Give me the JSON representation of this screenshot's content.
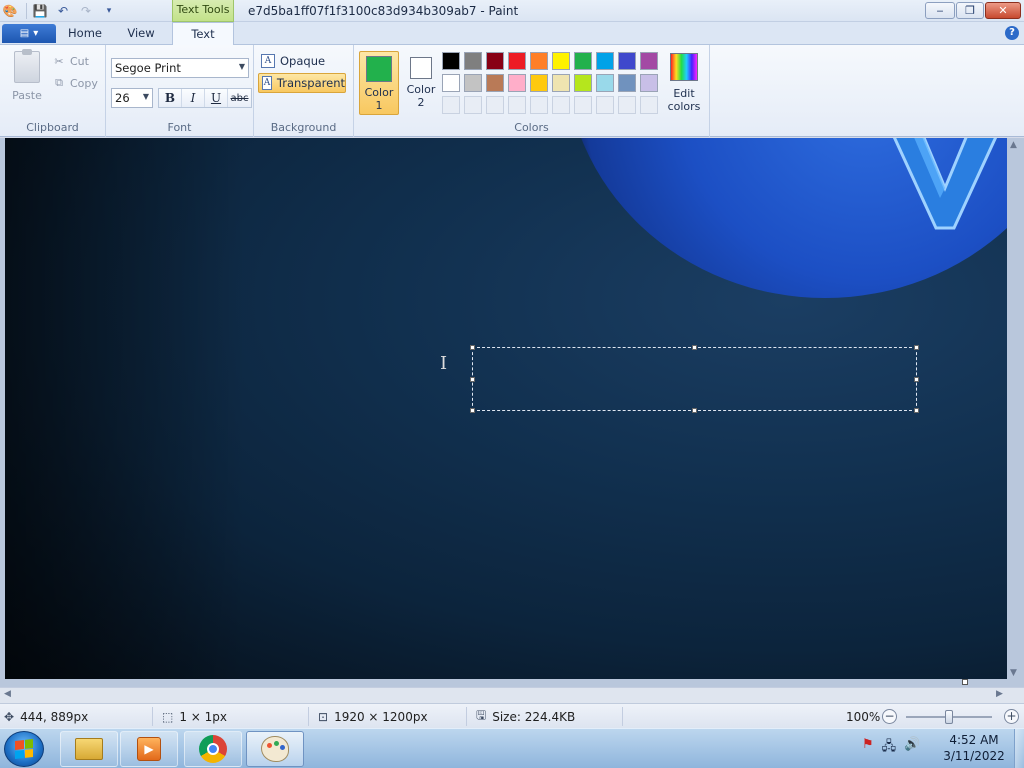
{
  "window": {
    "title": "e7d5ba1ff07f1f3100c83d934b309ab7 - Paint",
    "contextual_tab": "Text Tools",
    "controls": {
      "minimize": "‒",
      "maximize": "❐",
      "close": "✕"
    }
  },
  "ribbon": {
    "tabs": [
      {
        "label": "Home"
      },
      {
        "label": "View"
      },
      {
        "label": "Text",
        "active": true
      }
    ],
    "clipboard": {
      "label": "Clipboard",
      "paste": "Paste",
      "cut": "Cut",
      "copy": "Copy"
    },
    "font": {
      "label": "Font",
      "family": "Segoe Print",
      "size": "26",
      "bold": "B",
      "italic": "I",
      "underline": "U",
      "strikethrough": "abc"
    },
    "background": {
      "label": "Background",
      "opaque": "Opaque",
      "transparent": "Transparent",
      "selected": "Transparent"
    },
    "colors": {
      "label": "Colors",
      "color1_label_line1": "Color",
      "color1_label_line2": "1",
      "color2_label_line1": "Color",
      "color2_label_line2": "2",
      "color1": "#22b14c",
      "color2": "#ffffff",
      "edit_line1": "Edit",
      "edit_line2": "colors",
      "palette": [
        "#000000",
        "#7f7f7f",
        "#880015",
        "#ed1c24",
        "#ff7f27",
        "#fff200",
        "#22b14c",
        "#00a2e8",
        "#3f48cc",
        "#a349a4",
        "#ffffff",
        "#c3c3c3",
        "#b97a57",
        "#ffaec9",
        "#ffc90e",
        "#efe4b0",
        "#b5e61d",
        "#99d9ea",
        "#7092be",
        "#c8bfe7",
        "",
        "",
        "",
        "",
        "",
        "",
        "",
        "",
        "",
        ""
      ]
    }
  },
  "statusbar": {
    "cursor_pos": "444, 889px",
    "selection_size": "1 × 1px",
    "image_size": "1920 × 1200px",
    "file_size": "Size: 224.4KB",
    "zoom": "100%"
  },
  "taskbar": {
    "time": "4:52 AM",
    "date": "3/11/2022"
  }
}
